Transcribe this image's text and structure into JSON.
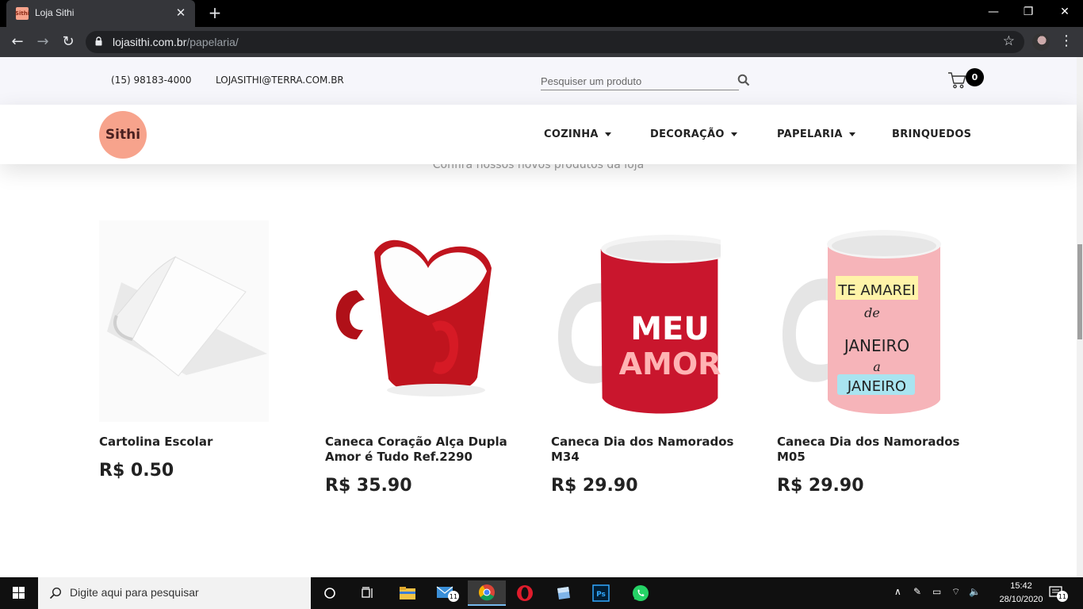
{
  "browser": {
    "tab_title": "Loja Sithi",
    "tab_favicon_text": "Sithi",
    "url_domain": "lojasithi.com.br",
    "url_path": "/papelaria/"
  },
  "topbar": {
    "phone": "(15) 98183-4000",
    "email": "LOJASITHI@TERRA.COM.BR",
    "search_placeholder": "Pesquiser um produto",
    "cart_count": "0"
  },
  "navbar": {
    "logo_text": "Sithi",
    "items": [
      {
        "label": "COZINHA",
        "has_dropdown": true
      },
      {
        "label": "DECORAÇÃO",
        "has_dropdown": true
      },
      {
        "label": "PAPELARIA",
        "has_dropdown": true
      },
      {
        "label": "BRINQUEDOS",
        "has_dropdown": false
      }
    ]
  },
  "section": {
    "subtitle": "Confira nossos novos produtos da loja"
  },
  "products": [
    {
      "name": "Cartolina Escolar",
      "price": "R$ 0.50",
      "image": "white-paper-sheet"
    },
    {
      "name": "Caneca Coração Alça Dupla Amor é Tudo Ref.2290",
      "price": "R$ 35.90",
      "image": "red-heart-mug"
    },
    {
      "name": "Caneca Dia dos Namorados M34",
      "price": "R$ 29.90",
      "image": "red-meu-amor-mug",
      "mug_text": [
        "MEU",
        "AMOR"
      ]
    },
    {
      "name": "Caneca Dia dos Namorados M05",
      "price": "R$ 29.90",
      "image": "pink-te-amarei-mug",
      "mug_text": [
        "TE AMAREI",
        "de",
        "JANEIRO",
        "a",
        "JANEIRO"
      ]
    }
  ],
  "taskbar": {
    "search_placeholder": "Digite aqui para pesquisar",
    "time": "15:42",
    "date": "28/10/2020",
    "mail_badge": "11",
    "notification_badge": "11"
  },
  "colors": {
    "brand": "#f7a38c",
    "topbar_bg": "#f6f6fb",
    "chrome_dark": "#35363a"
  }
}
